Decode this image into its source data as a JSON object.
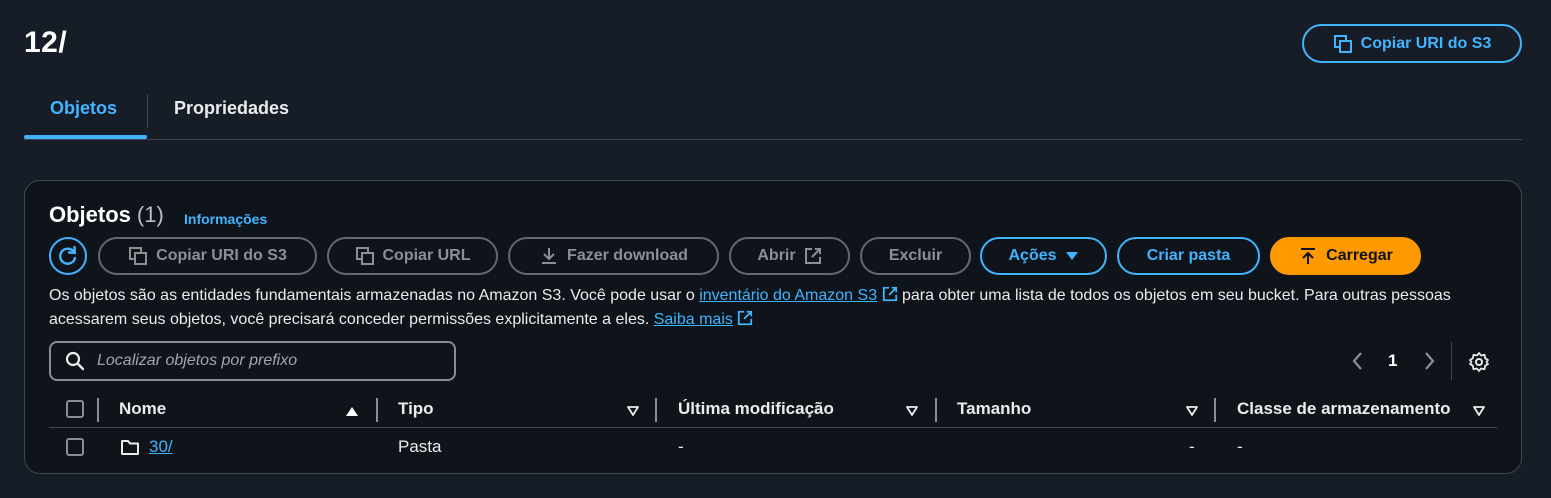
{
  "header": {
    "title": "12/",
    "copy_uri_label": "Copiar URI do S3"
  },
  "tabs": [
    {
      "label": "Objetos",
      "active": true
    },
    {
      "label": "Propriedades",
      "active": false
    }
  ],
  "objects_panel": {
    "heading": "Objetos",
    "count": "(1)",
    "info_link": "Informações",
    "toolbar": {
      "copy_uri": "Copiar URI do S3",
      "copy_url": "Copiar URL",
      "download": "Fazer download",
      "open": "Abrir",
      "delete": "Excluir",
      "actions": "Ações",
      "create_folder": "Criar pasta",
      "upload": "Carregar"
    },
    "description": {
      "part1": "Os objetos são as entidades fundamentais armazenadas no Amazon S3. Você pode usar o ",
      "inventory_link": "inventário do Amazon S3",
      "part2": " para obter uma lista de todos os objetos em seu bucket. Para outras pessoas acessarem seus objetos, você precisará conceder permissões explicitamente a eles. ",
      "learn_more": "Saiba mais"
    },
    "search": {
      "placeholder": "Localizar objetos por prefixo",
      "value": ""
    },
    "pagination": {
      "current_page": "1"
    },
    "table": {
      "columns": [
        "Nome",
        "Tipo",
        "Última modificação",
        "Tamanho",
        "Classe de armazenamento"
      ],
      "rows": [
        {
          "name": "30/",
          "type": "Pasta",
          "modified": "-",
          "size": "-",
          "storage_class": "-"
        }
      ]
    }
  },
  "colors": {
    "background": "#161d26",
    "accent": "#42b4ff",
    "upload_button": "#ff9900"
  },
  "icons": [
    "copy-icon",
    "refresh-icon",
    "download-icon",
    "external-link-icon",
    "caret-down-icon",
    "upload-icon",
    "search-icon",
    "chevron-left-icon",
    "chevron-right-icon",
    "gear-icon",
    "sort-ascending-icon",
    "sort-icon",
    "folder-icon"
  ]
}
